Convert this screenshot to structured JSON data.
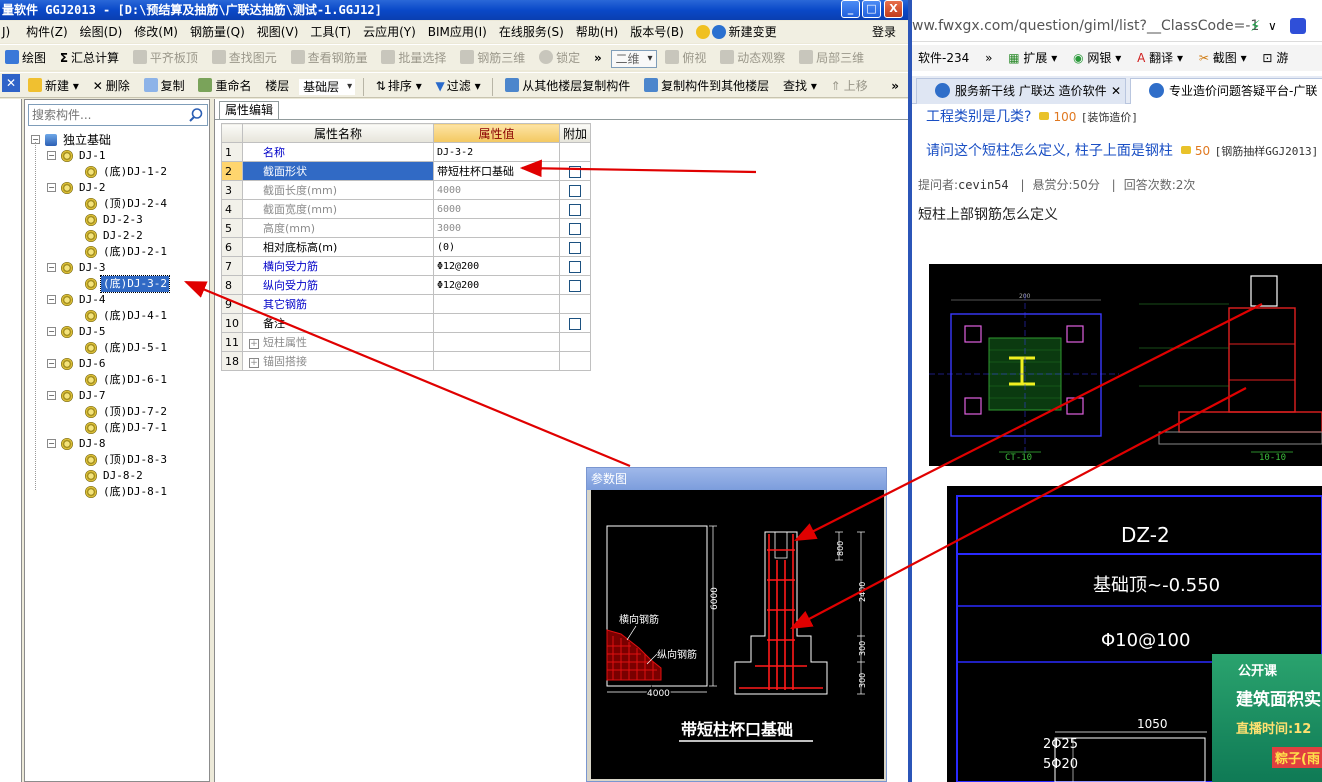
{
  "window": {
    "title": "量软件 GGJ2013 - [D:\\预结算及抽筋\\广联达抽筋\\测试-1.GGJ12]",
    "minimize": "_",
    "maximize": "□",
    "close": "X"
  },
  "menu": {
    "items": [
      "构件(Z)",
      "绘图(D)",
      "修改(M)",
      "钢筋量(Q)",
      "视图(V)",
      "工具(T)",
      "云应用(Y)",
      "BIM应用(I)",
      "在线服务(S)",
      "帮助(H)",
      "版本号(B)"
    ],
    "new_change": "新建变更",
    "login": "登录",
    "prefix": "J)"
  },
  "toolbar1": {
    "items": [
      "绘图",
      "汇总计算",
      "平齐板顶",
      "查找图元",
      "查看钢筋量",
      "批量选择",
      "钢筋三维",
      "锁定"
    ],
    "view_combo": "二维",
    "view_items": [
      "俯视",
      "动态观察",
      "局部三维"
    ],
    "more": "»"
  },
  "toolbar2": {
    "items": [
      "新建",
      "删除",
      "复制",
      "重命名",
      "楼层"
    ],
    "floor_combo": "基础层",
    "sort": "排序",
    "filter": "过滤",
    "copy_from": "从其他楼层复制构件",
    "copy_to": "复制构件到其他楼层",
    "find": "查找",
    "move_up": "上移",
    "more": "»"
  },
  "tree": {
    "search_placeholder": "搜索构件...",
    "root": "独立基础",
    "nodes": [
      {
        "label": "DJ-1",
        "children": [
          "(底)DJ-1-2"
        ]
      },
      {
        "label": "DJ-2",
        "children": [
          "(顶)DJ-2-4",
          "DJ-2-3",
          "DJ-2-2",
          "(底)DJ-2-1"
        ]
      },
      {
        "label": "DJ-3",
        "children": [
          "(底)DJ-3-2"
        ]
      },
      {
        "label": "DJ-4",
        "children": [
          "(底)DJ-4-1"
        ]
      },
      {
        "label": "DJ-5",
        "children": [
          "(底)DJ-5-1"
        ]
      },
      {
        "label": "DJ-6",
        "children": [
          "(底)DJ-6-1"
        ]
      },
      {
        "label": "DJ-7",
        "children": [
          "(顶)DJ-7-2",
          "(底)DJ-7-1"
        ]
      },
      {
        "label": "DJ-8",
        "children": [
          "(顶)DJ-8-3",
          "DJ-8-2",
          "(底)DJ-8-1"
        ]
      }
    ],
    "selected": "(底)DJ-3-2"
  },
  "props": {
    "tab": "属性编辑",
    "headers": [
      "属性名称",
      "属性值",
      "附加"
    ],
    "rows": [
      {
        "num": "1",
        "name": "名称",
        "value": "DJ-3-2",
        "style": "blue",
        "check": false
      },
      {
        "num": "2",
        "name": "截面形状",
        "value": "带短柱杯口基础",
        "style": "selected",
        "check": true
      },
      {
        "num": "3",
        "name": "截面长度(mm)",
        "value": "4000",
        "style": "gray",
        "check": true
      },
      {
        "num": "4",
        "name": "截面宽度(mm)",
        "value": "6000",
        "style": "gray",
        "check": true
      },
      {
        "num": "5",
        "name": "高度(mm)",
        "value": "3000",
        "style": "gray",
        "check": true
      },
      {
        "num": "6",
        "name": "相对底标高(m)",
        "value": "(0)",
        "style": "normal",
        "check": true
      },
      {
        "num": "7",
        "name": "横向受力筋",
        "value": "Φ12@200",
        "style": "blue",
        "check": true
      },
      {
        "num": "8",
        "name": "纵向受力筋",
        "value": "Φ12@200",
        "style": "blue",
        "check": true
      },
      {
        "num": "9",
        "name": "其它钢筋",
        "value": "",
        "style": "blue",
        "check": false
      },
      {
        "num": "10",
        "name": "备注",
        "value": "",
        "style": "normal",
        "check": true
      },
      {
        "num": "11",
        "name": "短柱属性",
        "value": "",
        "style": "gray-plus",
        "check": false
      },
      {
        "num": "18",
        "name": "锚固搭接",
        "value": "",
        "style": "gray-plus",
        "check": false
      }
    ]
  },
  "ref_dialog": {
    "title": "参数图",
    "caption": "带短柱杯口基础",
    "labels": {
      "horizontal": "横向钢筋",
      "vertical": "纵向钢筋",
      "width": "4000",
      "height": "6000",
      "d800": "800",
      "d2400": "2400",
      "d300a": "300",
      "d300b": "300"
    }
  },
  "browser": {
    "url": "ww.fwxgx.com/question/giml/list?__ClassCode=-1",
    "bookmarks": [
      "软件-234",
      "扩展",
      "网银",
      "翻译",
      "截图",
      "游"
    ],
    "bookmark_more": "»",
    "tabs": [
      "服务新干线 广联达 造价软件",
      "专业造价问题答疑平台-广联"
    ],
    "questions": [
      {
        "text": "工程类别是几类?",
        "points": "100",
        "tag": "[装饰造价]"
      },
      {
        "text": "请问这个短柱怎么定义, 柱子上面是钢柱",
        "points": "50",
        "tag": "[钢筋抽样GGJ2013]"
      }
    ],
    "asker_label": "提问者:",
    "asker": "cevin54",
    "bounty": "悬赏分:50分",
    "answers": "回答次数:2次",
    "body": "短柱上部钢筋怎么定义",
    "cad1": {
      "left_label": "CT-10",
      "right_label": "10-10",
      "dim": "200"
    },
    "cad2": {
      "title": "DZ-2",
      "elev": "基础顶~-0.550",
      "rebar": "Φ10@100",
      "dim": "1050",
      "r1": "2Φ25",
      "r2": "5Φ20"
    },
    "ad": {
      "line1": "公开课",
      "line2": "建筑面积实",
      "line3": "直播时间:12",
      "line4": "粽子(雨"
    }
  }
}
